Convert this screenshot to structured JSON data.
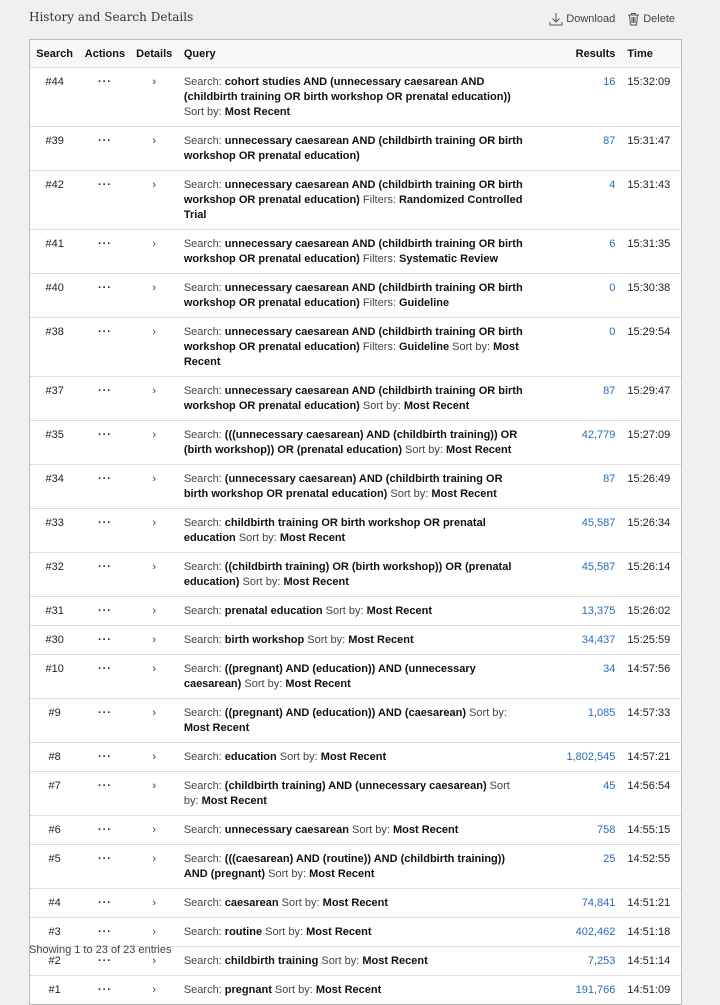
{
  "header": {
    "title": "History and Search Details",
    "download_label": "Download",
    "delete_label": "Delete"
  },
  "table": {
    "columns": [
      "Search",
      "Actions",
      "Details",
      "Query",
      "Results",
      "Time"
    ],
    "rows": [
      {
        "id": "#44",
        "results": "16",
        "time": "15:32:09",
        "query": [
          {
            "t": "Search: ",
            "b": false
          },
          {
            "t": "cohort studies AND (unnecessary caesarean AND (childbirth training OR birth workshop OR prenatal education))",
            "b": true
          },
          {
            "t": " Sort by: ",
            "b": false
          },
          {
            "t": "Most Recent",
            "b": true
          }
        ]
      },
      {
        "id": "#39",
        "results": "87",
        "time": "15:31:47",
        "query": [
          {
            "t": "Search: ",
            "b": false
          },
          {
            "t": "unnecessary caesarean AND (childbirth training OR birth workshop OR prenatal education)",
            "b": true
          }
        ]
      },
      {
        "id": "#42",
        "results": "4",
        "time": "15:31:43",
        "query": [
          {
            "t": "Search: ",
            "b": false
          },
          {
            "t": "unnecessary caesarean AND (childbirth training OR birth workshop OR prenatal education)",
            "b": true
          },
          {
            "t": " Filters: ",
            "b": false
          },
          {
            "t": "Randomized Controlled Trial",
            "b": true
          }
        ]
      },
      {
        "id": "#41",
        "results": "6",
        "time": "15:31:35",
        "query": [
          {
            "t": "Search: ",
            "b": false
          },
          {
            "t": "unnecessary caesarean AND (childbirth training OR birth workshop OR prenatal education)",
            "b": true
          },
          {
            "t": " Filters: ",
            "b": false
          },
          {
            "t": "Systematic Review",
            "b": true
          }
        ]
      },
      {
        "id": "#40",
        "results": "0",
        "time": "15:30:38",
        "query": [
          {
            "t": "Search: ",
            "b": false
          },
          {
            "t": "unnecessary caesarean AND (childbirth training OR birth workshop OR prenatal education)",
            "b": true
          },
          {
            "t": " Filters: ",
            "b": false
          },
          {
            "t": "Guideline",
            "b": true
          }
        ]
      },
      {
        "id": "#38",
        "results": "0",
        "time": "15:29:54",
        "query": [
          {
            "t": "Search: ",
            "b": false
          },
          {
            "t": "unnecessary caesarean AND (childbirth training OR birth workshop OR prenatal education)",
            "b": true
          },
          {
            "t": " Filters: ",
            "b": false
          },
          {
            "t": "Guideline",
            "b": true
          },
          {
            "t": " Sort by: ",
            "b": false
          },
          {
            "t": "Most Recent",
            "b": true
          }
        ]
      },
      {
        "id": "#37",
        "results": "87",
        "time": "15:29:47",
        "query": [
          {
            "t": "Search: ",
            "b": false
          },
          {
            "t": "unnecessary caesarean AND (childbirth training OR birth workshop OR prenatal education)",
            "b": true
          },
          {
            "t": " Sort by: ",
            "b": false
          },
          {
            "t": "Most Recent",
            "b": true
          }
        ]
      },
      {
        "id": "#35",
        "results": "42,779",
        "time": "15:27:09",
        "query": [
          {
            "t": "Search: ",
            "b": false
          },
          {
            "t": "(((unnecessary caesarean) AND (childbirth training)) OR (birth workshop)) OR (prenatal education)",
            "b": true
          },
          {
            "t": " Sort by: ",
            "b": false
          },
          {
            "t": "Most Recent",
            "b": true
          }
        ]
      },
      {
        "id": "#34",
        "results": "87",
        "time": "15:26:49",
        "query": [
          {
            "t": "Search: ",
            "b": false
          },
          {
            "t": "(unnecessary caesarean) AND (childbirth training OR birth workshop OR prenatal education)",
            "b": true
          },
          {
            "t": " Sort by: ",
            "b": false
          },
          {
            "t": "Most Recent",
            "b": true
          }
        ]
      },
      {
        "id": "#33",
        "results": "45,587",
        "time": "15:26:34",
        "query": [
          {
            "t": "Search: ",
            "b": false
          },
          {
            "t": "childbirth training OR birth workshop OR prenatal education",
            "b": true
          },
          {
            "t": " Sort by: ",
            "b": false
          },
          {
            "t": "Most Recent",
            "b": true
          }
        ]
      },
      {
        "id": "#32",
        "results": "45,587",
        "time": "15:26:14",
        "query": [
          {
            "t": "Search: ",
            "b": false
          },
          {
            "t": "((childbirth training) OR (birth workshop)) OR (prenatal education)",
            "b": true
          },
          {
            "t": " Sort by: ",
            "b": false
          },
          {
            "t": "Most Recent",
            "b": true
          }
        ]
      },
      {
        "id": "#31",
        "results": "13,375",
        "time": "15:26:02",
        "query": [
          {
            "t": "Search: ",
            "b": false
          },
          {
            "t": "prenatal education",
            "b": true
          },
          {
            "t": " Sort by: ",
            "b": false
          },
          {
            "t": "Most Recent",
            "b": true
          }
        ]
      },
      {
        "id": "#30",
        "results": "34,437",
        "time": "15:25:59",
        "query": [
          {
            "t": "Search: ",
            "b": false
          },
          {
            "t": "birth workshop",
            "b": true
          },
          {
            "t": " Sort by: ",
            "b": false
          },
          {
            "t": "Most Recent",
            "b": true
          }
        ]
      },
      {
        "id": "#10",
        "results": "34",
        "time": "14:57:56",
        "query": [
          {
            "t": "Search: ",
            "b": false
          },
          {
            "t": "((pregnant) AND (education)) AND (unnecessary caesarean)",
            "b": true
          },
          {
            "t": " Sort by: ",
            "b": false
          },
          {
            "t": "Most Recent",
            "b": true
          }
        ]
      },
      {
        "id": "#9",
        "results": "1,085",
        "time": "14:57:33",
        "query": [
          {
            "t": "Search: ",
            "b": false
          },
          {
            "t": "((pregnant) AND (education)) AND (caesarean)",
            "b": true
          },
          {
            "t": " Sort by: ",
            "b": false
          },
          {
            "t": "Most Recent",
            "b": true
          }
        ]
      },
      {
        "id": "#8",
        "results": "1,802,545",
        "time": "14:57:21",
        "query": [
          {
            "t": "Search: ",
            "b": false
          },
          {
            "t": "education",
            "b": true
          },
          {
            "t": " Sort by: ",
            "b": false
          },
          {
            "t": "Most Recent",
            "b": true
          }
        ]
      },
      {
        "id": "#7",
        "results": "45",
        "time": "14:56:54",
        "query": [
          {
            "t": "Search: ",
            "b": false
          },
          {
            "t": "(childbirth training) AND (unnecessary caesarean)",
            "b": true
          },
          {
            "t": " Sort by: ",
            "b": false
          },
          {
            "t": "Most Recent",
            "b": true
          }
        ]
      },
      {
        "id": "#6",
        "results": "758",
        "time": "14:55:15",
        "query": [
          {
            "t": "Search: ",
            "b": false
          },
          {
            "t": "unnecessary caesarean",
            "b": true
          },
          {
            "t": " Sort by: ",
            "b": false
          },
          {
            "t": "Most Recent",
            "b": true
          }
        ]
      },
      {
        "id": "#5",
        "results": "25",
        "time": "14:52:55",
        "query": [
          {
            "t": "Search: ",
            "b": false
          },
          {
            "t": "(((caesarean) AND (routine)) AND (childbirth training)) AND (pregnant)",
            "b": true
          },
          {
            "t": " Sort by: ",
            "b": false
          },
          {
            "t": "Most Recent",
            "b": true
          }
        ]
      },
      {
        "id": "#4",
        "results": "74,841",
        "time": "14:51:21",
        "query": [
          {
            "t": "Search: ",
            "b": false
          },
          {
            "t": "caesarean",
            "b": true
          },
          {
            "t": " Sort by: ",
            "b": false
          },
          {
            "t": "Most Recent",
            "b": true
          }
        ]
      },
      {
        "id": "#3",
        "results": "402,462",
        "time": "14:51:18",
        "query": [
          {
            "t": "Search: ",
            "b": false
          },
          {
            "t": "routine",
            "b": true
          },
          {
            "t": " Sort by: ",
            "b": false
          },
          {
            "t": "Most Recent",
            "b": true
          }
        ]
      },
      {
        "id": "#2",
        "results": "7,253",
        "time": "14:51:14",
        "query": [
          {
            "t": "Search: ",
            "b": false
          },
          {
            "t": "childbirth training",
            "b": true
          },
          {
            "t": " Sort by: ",
            "b": false
          },
          {
            "t": "Most Recent",
            "b": true
          }
        ]
      },
      {
        "id": "#1",
        "results": "191,766",
        "time": "14:51:09",
        "query": [
          {
            "t": "Search: ",
            "b": false
          },
          {
            "t": "pregnant",
            "b": true
          },
          {
            "t": " Sort by: ",
            "b": false
          },
          {
            "t": "Most Recent",
            "b": true
          }
        ]
      }
    ],
    "actions_glyph": "···",
    "details_glyph": "›"
  },
  "footer": {
    "entries_text": "Showing 1 to 23 of 23 entries"
  },
  "colors": {
    "link": "#2a6cb8",
    "background": "#f0f0f0"
  },
  "icons": [
    "download-icon",
    "trash-icon",
    "more-actions-icon",
    "chevron-right-icon"
  ]
}
